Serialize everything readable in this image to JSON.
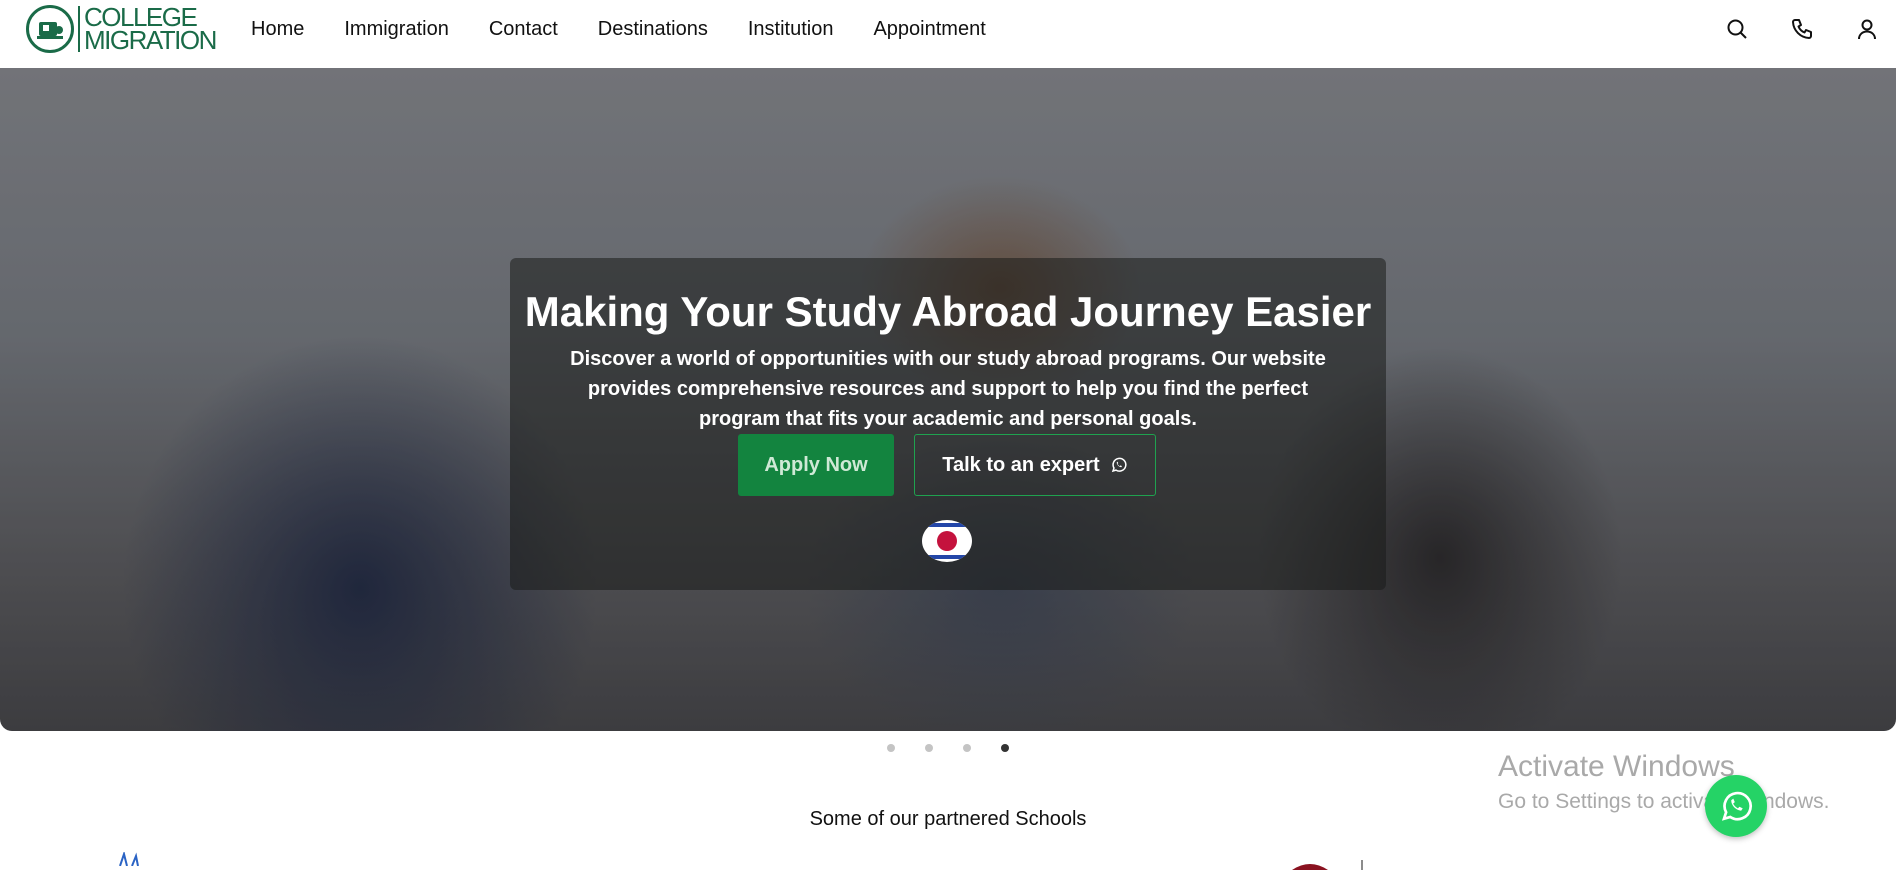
{
  "brand": {
    "logo_line1": "COLLEGE",
    "logo_line2": "MIGRATION",
    "color": "#1a6b48"
  },
  "nav": {
    "items": [
      "Home",
      "Immigration",
      "Contact",
      "Destinations",
      "Institution",
      "Appointment"
    ]
  },
  "header_icons": [
    "search-icon",
    "phone-icon",
    "user-icon"
  ],
  "hero": {
    "title": "Making Your Study Abroad Journey Easier",
    "description": "Discover a world of opportunities with our study abroad programs. Our website provides comprehensive resources and support to help you find the perfect program that fits your academic and personal goals.",
    "apply_label": "Apply Now",
    "expert_label": "Talk to an expert",
    "accent_color": "#13843f"
  },
  "carousel": {
    "slides": 4,
    "active_index": 3
  },
  "partners": {
    "title": "Some of our partnered Schools"
  },
  "watermark": {
    "line1": "Activate Windows",
    "line2": "Go to Settings to activate Windows."
  }
}
